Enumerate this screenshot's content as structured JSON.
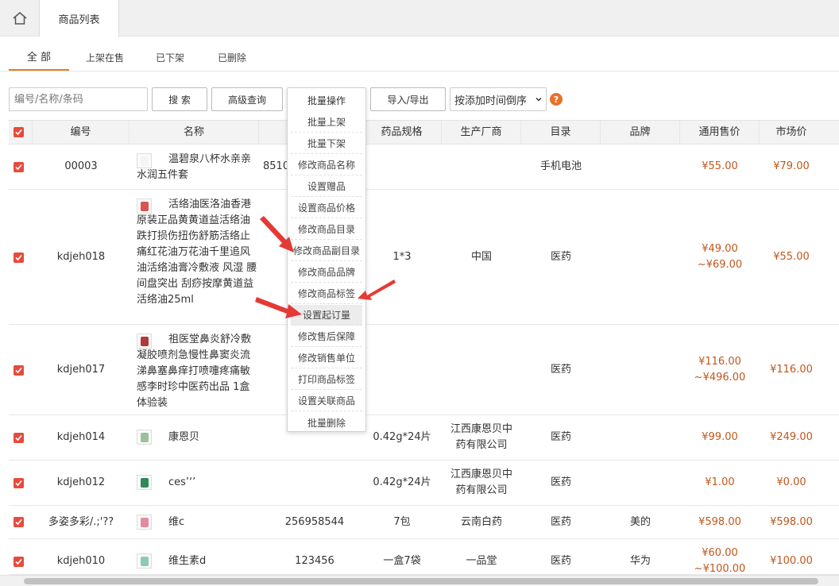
{
  "header": {
    "page_tab": "商品列表"
  },
  "filter_tabs": [
    {
      "label": "全  部"
    },
    {
      "label": "上架在售"
    },
    {
      "label": "已下架"
    },
    {
      "label": "已删除"
    }
  ],
  "toolbar": {
    "search_placeholder": "编号/名称/条码",
    "search_button": "搜 索",
    "advanced_button": "高级查询",
    "batch_button": "批量操作",
    "import_export_button": "导入/导出",
    "sort_value": "按添加时间倒序",
    "help": "?"
  },
  "batch_menu": [
    "批量上架",
    "批量下架",
    "修改商品名称",
    "设置赠品",
    "设置商品价格",
    "修改商品目录",
    "修改商品副目录",
    "修改商品品牌",
    "修改商品标签",
    "设置起订量",
    "修改售后保障",
    "修改销售单位",
    "打印商品标签",
    "设置关联商品",
    "批量删除"
  ],
  "columns": [
    "编号",
    "名称",
    "药品规格",
    "生产厂商",
    "目录",
    "品牌",
    "通用售价",
    "市场价"
  ],
  "rows": [
    {
      "code": "00003",
      "name": "温碧泉八杯水亲亲水润五件套",
      "barcode": "8510",
      "spec": "",
      "maker": "",
      "catalog": "手机电池",
      "brand": "",
      "price": "¥55.00",
      "market": "¥79.00"
    },
    {
      "code": "kdjeh018",
      "name": "活络油医洛油香港原装正品黄黄道益活络油跌打损伤扭伤舒筋活络止痛红花油万花油千里追风油活络油膏冷敷液 风湿 腰间盘突出 刮痧按摩黄道益活络油25ml",
      "barcode": "",
      "spec": "1*3",
      "maker": "中国",
      "catalog": "医药",
      "brand": "",
      "price": "¥49.00",
      "price2": "~¥69.00",
      "market": "¥55.00"
    },
    {
      "code": "kdjeh017",
      "name": "祖医堂鼻炎舒冷敷凝胶喷剂急慢性鼻窦炎流涕鼻塞鼻痒打喷嚏疼痛敏感李时珍中医药出品 1盒体验装",
      "barcode": "",
      "spec": "",
      "maker": "",
      "catalog": "医药",
      "brand": "",
      "price": "¥116.00",
      "price2": "~¥496.00",
      "market": "¥116.00"
    },
    {
      "code": "kdjeh014",
      "name": "康恩贝",
      "barcode": "",
      "spec": "0.42g*24片",
      "maker": "江西康恩贝中药有限公司",
      "catalog": "医药",
      "brand": "",
      "price": "¥99.00",
      "market": "¥249.00"
    },
    {
      "code": "kdjeh012",
      "name": "ces’‘’",
      "barcode": "",
      "spec": "0.42g*24片",
      "maker": "江西康恩贝中药有限公司",
      "catalog": "医药",
      "brand": "",
      "price": "¥1.00",
      "market": "¥0.00"
    },
    {
      "code": "多姿多彩/.;'??",
      "name": "维c",
      "barcode": "256958544",
      "spec": "7包",
      "maker": "云南白药",
      "catalog": "医药",
      "brand": "美的",
      "price": "¥598.00",
      "market": "¥598.00"
    },
    {
      "code": "kdjeh010",
      "name": "维生素d",
      "barcode": "123456",
      "spec": "一盒7袋",
      "maker": "一品堂",
      "catalog": "医药",
      "brand": "华为",
      "price": "¥60.00",
      "price2": "~¥100.00",
      "market": "¥100.00"
    }
  ],
  "colors": {
    "accent": "#e67e22",
    "checkbox": "#e64b3c",
    "price": "#c0571c",
    "arrow": "#e53935"
  },
  "icons": {
    "home": "home-icon",
    "help": "help-icon",
    "chevron": "chevron-down-icon"
  }
}
